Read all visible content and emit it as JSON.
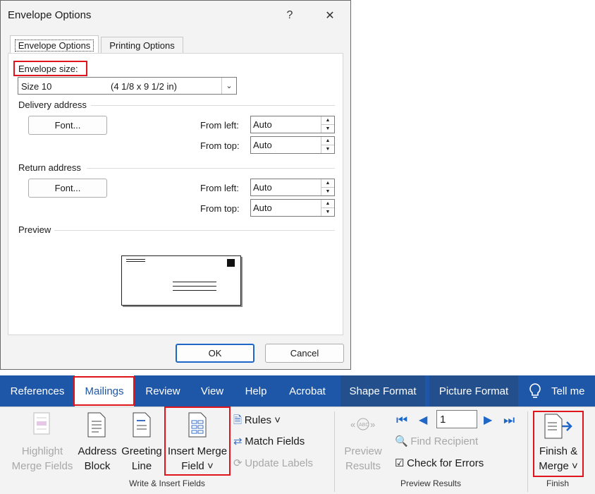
{
  "dialog": {
    "title": "Envelope Options",
    "help": "?",
    "close": "✕",
    "tabs": [
      "Envelope Options",
      "Printing Options"
    ],
    "envelope_size_label": "Envelope size:",
    "envelope_size_name": "Size 10",
    "envelope_size_dims": "(4 1/8 x 9 1/2 in)",
    "delivery": {
      "title": "Delivery address",
      "font_button": "Font...",
      "from_left_label": "From left:",
      "from_left_value": "Auto",
      "from_top_label": "From top:",
      "from_top_value": "Auto"
    },
    "return": {
      "title": "Return address",
      "font_button": "Font...",
      "from_left_label": "From left:",
      "from_left_value": "Auto",
      "from_top_label": "From top:",
      "from_top_value": "Auto"
    },
    "preview_label": "Preview",
    "ok": "OK",
    "cancel": "Cancel"
  },
  "ribbon": {
    "tabs": [
      "References",
      "Mailings",
      "Review",
      "View",
      "Help",
      "Acrobat",
      "Shape Format",
      "Picture Format"
    ],
    "active_tab": "Mailings",
    "tell_me": "Tell me",
    "write_insert": {
      "highlight": [
        "Highlight",
        "Merge Fields"
      ],
      "address_block": [
        "Address",
        "Block"
      ],
      "greeting_line": [
        "Greeting",
        "Line"
      ],
      "insert_merge_field": [
        "Insert Merge",
        "Field ˅"
      ],
      "rules": "Rules ˅",
      "match_fields": "Match Fields",
      "update_labels": "Update Labels",
      "group_label": "Write & Insert Fields"
    },
    "preview_results": {
      "preview": [
        "Preview",
        "Results"
      ],
      "record_number": "1",
      "find_recipient": "Find Recipient",
      "check_errors": "Check for Errors",
      "group_label": "Preview Results"
    },
    "finish": {
      "finish_merge": [
        "Finish &",
        "Merge ˅"
      ],
      "group_label": "Finish"
    }
  },
  "colors": {
    "ribbon_blue": "#1e57a8",
    "highlight_red": "#e0141b"
  }
}
